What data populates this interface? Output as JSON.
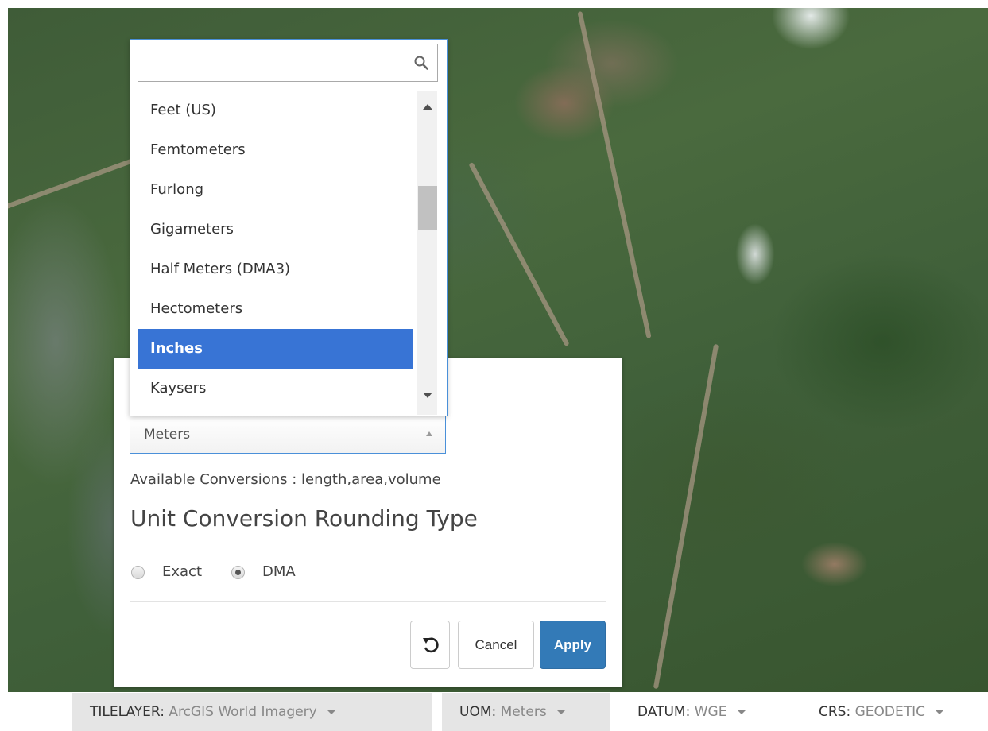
{
  "search": {
    "placeholder": "",
    "value": ""
  },
  "unit_list": {
    "items": [
      "Feet (US)",
      "Femtometers",
      "Furlong",
      "Gigameters",
      "Half Meters (DMA3)",
      "Hectometers",
      "Inches",
      "Kaysers"
    ],
    "selected": "Inches"
  },
  "panel": {
    "select_value": "Meters",
    "available_conversions": "Available Conversions : length,area,volume",
    "rounding_title": "Unit Conversion Rounding Type",
    "radio_exact": "Exact",
    "radio_dma": "DMA",
    "radio_selected": "DMA",
    "cancel_label": "Cancel",
    "apply_label": "Apply"
  },
  "status_bar": {
    "tilelayer_key": "TILELAYER:",
    "tilelayer_val": "ArcGIS World Imagery",
    "uom_key": "UOM:",
    "uom_val": "Meters",
    "datum_key": "DATUM:",
    "datum_val": "WGE",
    "crs_key": "CRS:",
    "crs_val": "GEODETIC"
  },
  "icons": {
    "search": "search-icon",
    "reset": "reset-icon",
    "caret": "caret-down-icon"
  },
  "colors": {
    "selected_item": "#3874d5",
    "apply_button": "#337ab7",
    "dropdown_border": "#4a90d9"
  }
}
